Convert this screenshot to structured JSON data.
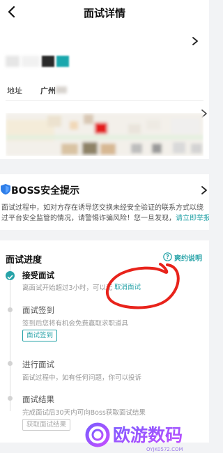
{
  "header": {
    "title": "面试详情"
  },
  "address": {
    "label": "地址",
    "value": "广州"
  },
  "safety": {
    "title": "BOSS安全提示",
    "line1": "面试过程中，如对方存在诱导您交换未经安全验证的联系方式以绕",
    "line2_prefix": "过平台安全监管的情况，请警惕诈骗风险！您一旦发现，",
    "report_link": "请立即举报"
  },
  "progress": {
    "title": "面试进度",
    "contract_link": "爽约说明",
    "steps": [
      {
        "title": "接受面试",
        "desc": "离面试开始超过3小时，可以无",
        "action_link": "取消面试"
      },
      {
        "title": "面试签到",
        "desc": "签到后您将有机会免费赢取求职道具",
        "button": "面试签到"
      },
      {
        "title": "进行面试",
        "desc": "面试过程中，如有任何问题，你可以投诉"
      },
      {
        "title": "面试结果",
        "desc": "完成面试后30天内可向Boss获取面试结果",
        "button": "获取面试结果"
      }
    ]
  },
  "watermark": {
    "text": "欧游数码",
    "url": "OYJK0572.COM"
  },
  "colors": {
    "accent": "#27a3a8",
    "annotation": "#e8231b"
  }
}
